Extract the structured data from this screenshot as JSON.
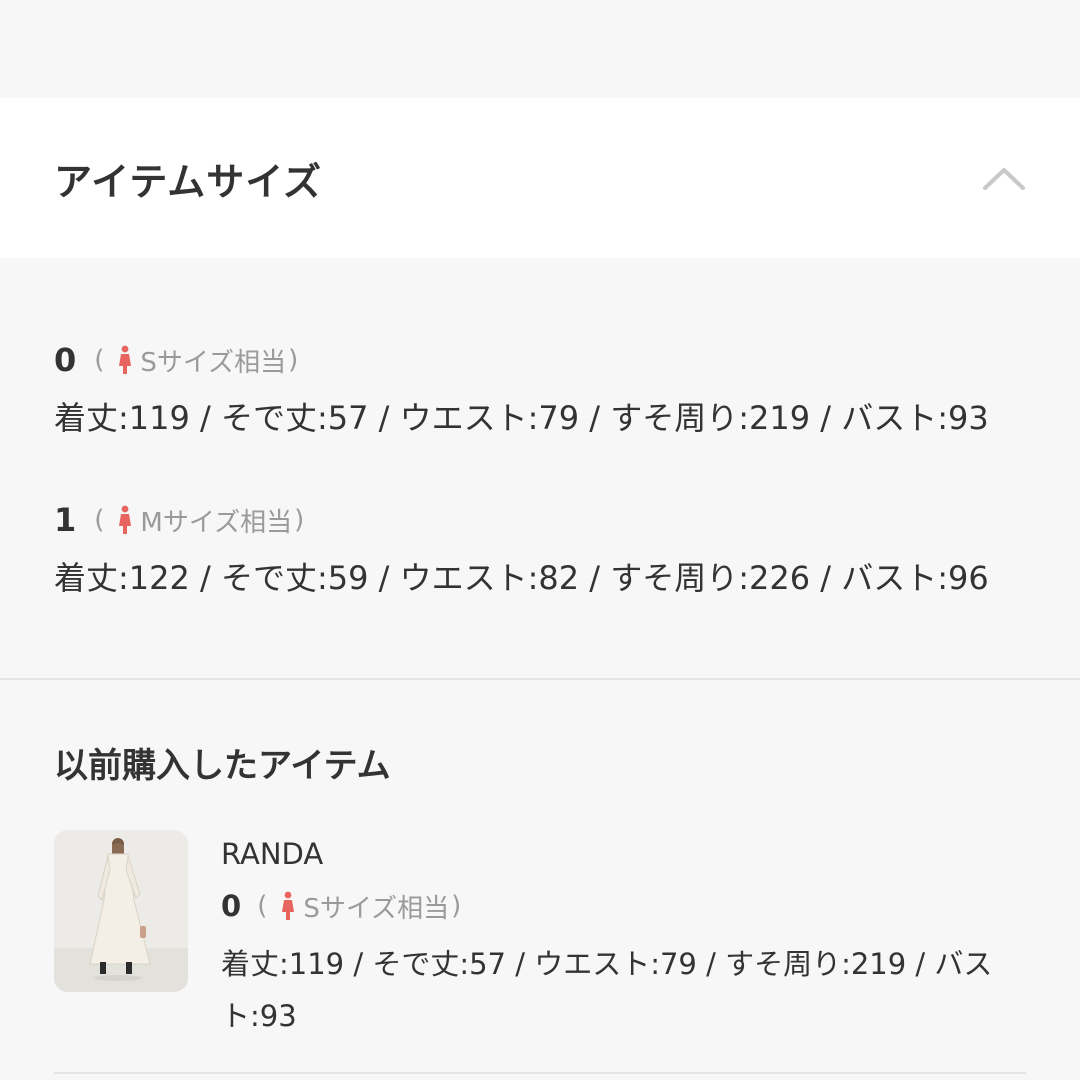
{
  "header": {
    "title": "アイテムサイズ"
  },
  "sizes": [
    {
      "number": "0",
      "open_paren": "(",
      "label": "Sサイズ相当",
      "close_paren": ")",
      "measurements": "着丈:119 / そで丈:57 / ウエスト:79 / すそ周り:219 / バスト:93"
    },
    {
      "number": "1",
      "open_paren": "(",
      "label": "Mサイズ相当",
      "close_paren": ")",
      "measurements": "着丈:122 / そで丈:59 / ウエスト:82 / すそ周り:226 / バスト:96"
    }
  ],
  "history": {
    "title": "以前購入したアイテム",
    "item": {
      "brand": "RANDA",
      "number": "0",
      "open_paren": "(",
      "label": "Sサイズ相当",
      "close_paren": ")",
      "measurements": "着丈:119 / そで丈:57 / ウエスト:79 / すそ周り:219 / バスト:93"
    }
  },
  "icons": {
    "collapse": "chevron-up-icon",
    "size": "person-icon"
  },
  "colors": {
    "accent": "#e8655f",
    "text": "#333333",
    "muted": "#9a9a9a",
    "chevron": "#c8c8c8"
  }
}
